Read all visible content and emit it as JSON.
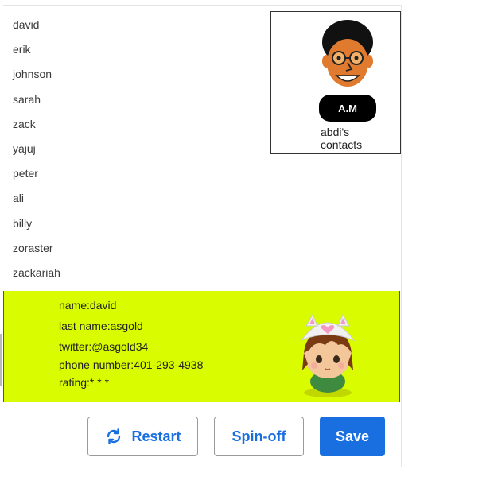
{
  "contacts": [
    "david",
    "erik",
    "johnson",
    "sarah",
    "zack",
    "yajuj",
    "peter",
    "ali",
    "billy",
    "zoraster",
    "zackariah"
  ],
  "profile": {
    "badge_text": "A.M",
    "caption_line1": "abdi's",
    "caption_line2": "contacts"
  },
  "detail": {
    "name": "name:david",
    "last_name": "last name:asgold",
    "twitter": "twitter:@asgold34",
    "phone": "phone number:401-293-4938",
    "rating": "rating:* * *",
    "background_color": "#d9fc00"
  },
  "buttons": {
    "restart": "Restart",
    "spinoff": "Spin-off",
    "save": "Save"
  },
  "colors": {
    "accent": "#1a6fe0"
  },
  "icons": {
    "restart": "refresh-icon"
  }
}
